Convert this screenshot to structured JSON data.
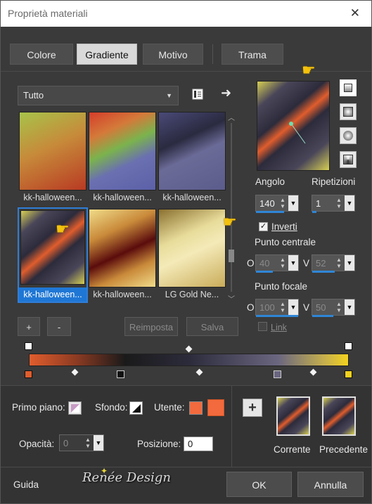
{
  "window": {
    "title": "Proprietà materiali"
  },
  "tabs": [
    {
      "label": "Colore",
      "active": false
    },
    {
      "label": "Gradiente",
      "active": true
    },
    {
      "label": "Motivo",
      "active": false
    },
    {
      "label": "Trama",
      "active": false
    }
  ],
  "category": {
    "selected": "Tutto"
  },
  "thumbnails": [
    {
      "label": "kk-halloween...",
      "selected": false
    },
    {
      "label": "kk-halloween...",
      "selected": false
    },
    {
      "label": "kk-halloween...",
      "selected": false
    },
    {
      "label": "kk-halloween...",
      "selected": true
    },
    {
      "label": "kk-halloween...",
      "selected": false
    },
    {
      "label": "LG Gold Ne...",
      "selected": false
    }
  ],
  "buttons": {
    "add": "+",
    "remove": "-",
    "reset": "Reimposta",
    "save": "Salva"
  },
  "angle": {
    "label": "Angolo",
    "value": "140"
  },
  "repeats": {
    "label": "Ripetizioni",
    "value": "1"
  },
  "invert": {
    "label": "Inverti",
    "checked": true
  },
  "center_point": {
    "label": "Punto centrale",
    "o_label": "O",
    "o_value": "40",
    "v_label": "V",
    "v_value": "52"
  },
  "focal_point": {
    "label": "Punto focale",
    "o_label": "O",
    "o_value": "100",
    "v_label": "V",
    "v_value": "50"
  },
  "link": {
    "label": "Link",
    "checked": false
  },
  "bottom": {
    "foreground_label": "Primo piano:",
    "background_label": "Sfondo:",
    "user_label": "Utente:",
    "user_color": "#f26a3d",
    "opacity_label": "Opacità:",
    "opacity_value": "0",
    "position_label": "Posizione:",
    "position_value": "0",
    "current_label": "Corrente",
    "previous_label": "Precedente"
  },
  "watermark": "Renée Design",
  "footer": {
    "help": "Guida",
    "ok": "OK",
    "cancel": "Annulla"
  },
  "colors": {
    "accent": "#1f77d5",
    "orange": "#e05d2d",
    "yellow": "#f2d21e",
    "dark": "#2c2b3b"
  }
}
